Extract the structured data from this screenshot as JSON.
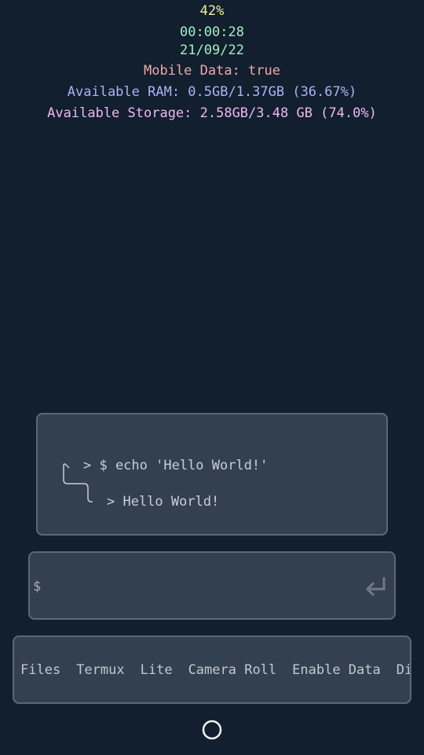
{
  "status": {
    "battery": "42%",
    "clock": "00:00:28",
    "date": "21/09/22",
    "mobile_data": "Mobile Data: true",
    "ram": "Available RAM: 0.5GB/1.37GB (36.67%)",
    "storage": "Available Storage: 2.58GB/3.48 GB (74.0%)"
  },
  "terminal": {
    "command_line": "> $ echo 'Hello World!'",
    "output_line": "> Hello World!"
  },
  "input": {
    "prompt": "$",
    "value": "",
    "enter_icon": "enter-icon"
  },
  "apps": {
    "items": [
      "Files",
      "Termux",
      "Lite",
      "Camera Roll",
      "Enable Data",
      "Dis"
    ]
  },
  "nav": {
    "home_icon": "home-circle-icon"
  },
  "colors": {
    "background": "#111f2f",
    "card": "#33404f",
    "card_border": "#5b6878",
    "battery": "#f1ef9a",
    "time": "#a6eec1",
    "mobile_data": "#f2a8a8",
    "ram": "#a9b5f3",
    "storage": "#f0b6f2"
  }
}
